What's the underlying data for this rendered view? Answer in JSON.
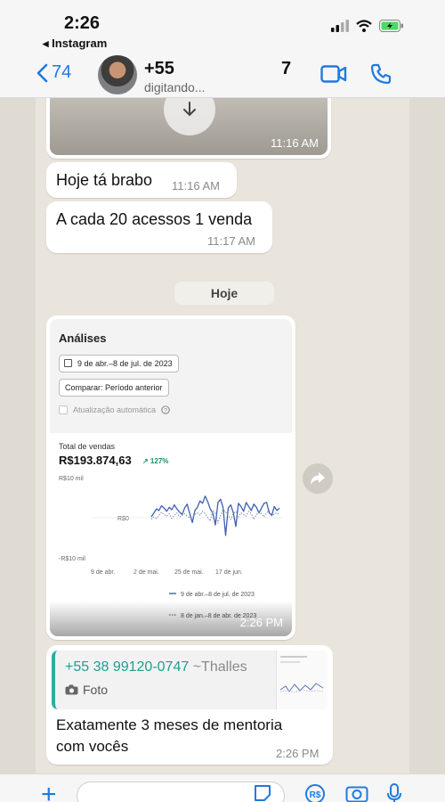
{
  "status_bar": {
    "time": "2:26",
    "back_app": "◂ Instagram"
  },
  "header": {
    "back_count": "74",
    "contact_name_start": "+55",
    "contact_name_end": "7",
    "status": "digitando..."
  },
  "messages": {
    "image_time": "11:16 AM",
    "msg1_text": "Hoje tá brabo",
    "msg1_time": "11:16 AM",
    "msg2_text": "A cada 20 acessos 1 venda",
    "msg2_time": "11:17 AM",
    "date_chip": "Hoje",
    "screenshot": {
      "title": "Análises",
      "date_range": "9 de abr.–8 de jul. de 2023",
      "compare": "Comparar: Período anterior",
      "auto_update": "Atualização automática",
      "metric_label": "Total de vendas",
      "metric_value": "R$193.874,63",
      "metric_growth": "↗ 127%",
      "time": "2:26 PM"
    },
    "reply": {
      "quoted_name": "+55 38 99120-0747",
      "quoted_alias": " ~Thalles",
      "quoted_type": "Foto",
      "text_line1": "Exatamente 3 meses de mentoria",
      "text_line2": "com vocês",
      "time": "2:26 PM"
    }
  },
  "chart_data": {
    "type": "line",
    "title": "",
    "xlabel": "",
    "ylabel": "",
    "y_tick_labels": [
      "R$10 mil",
      "R$0",
      "-R$10 mil"
    ],
    "ylim": [
      -10000,
      10000
    ],
    "x_tick_labels": [
      "9 de abr.",
      "2 de mai.",
      "25 de mai.",
      "17 de jun."
    ],
    "series": [
      {
        "name": "9 de abr.–8 de jul. de 2023",
        "style": "solid",
        "color": "#3f5fb0",
        "values": [
          200,
          1200,
          2200,
          1800,
          3000,
          2400,
          1600,
          2600,
          2000,
          3200,
          2200,
          1400,
          800,
          2400,
          3400,
          1000,
          -1200,
          1800,
          2600,
          4200,
          3600,
          5400,
          4000,
          2200,
          1200,
          -1800,
          3800,
          4600,
          2600,
          -4400,
          2400,
          3200,
          1200,
          -2200,
          3600,
          2800,
          1600,
          3800,
          2800,
          1800,
          3400,
          2600,
          1200,
          2400,
          3600,
          3800,
          1200,
          600,
          2800,
          1800,
          2400
        ]
      },
      {
        "name": "8 de jan.–8 de abr. de 2023",
        "style": "dotted",
        "color": "#7a8aa6",
        "values": [
          -400,
          200,
          -200,
          600,
          1400,
          800,
          400,
          1000,
          -200,
          600,
          1200,
          200,
          600,
          1000,
          400,
          0,
          200,
          800,
          1200,
          600,
          1600,
          1000,
          0,
          -800,
          1800,
          1200,
          -1400,
          600,
          2000,
          1400,
          600,
          -400,
          1000,
          1600,
          200,
          1200,
          800,
          400,
          1600,
          1000,
          -400,
          800,
          1400,
          1000,
          200,
          1200,
          1800,
          400,
          1000,
          1200,
          800
        ]
      }
    ],
    "legend": "bottom",
    "grid": false
  },
  "composer": {
    "placeholder": ""
  },
  "colors": {
    "accent": "#1f7ae0",
    "quote_accent": "#25b0a3",
    "chart_line": "#3f5fb0"
  }
}
